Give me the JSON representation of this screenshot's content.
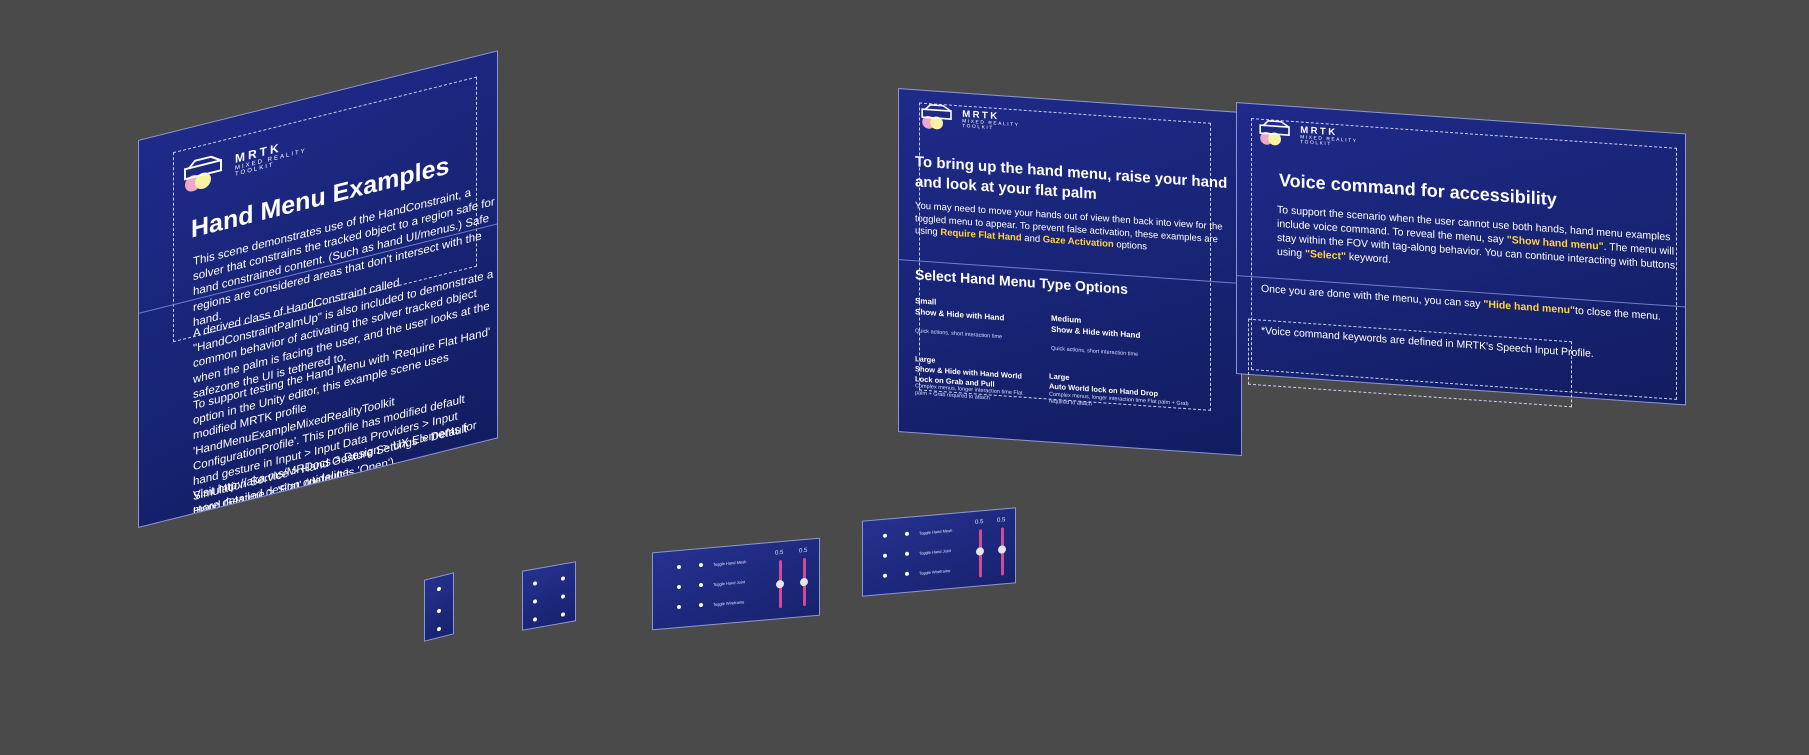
{
  "logo": {
    "title": "MRTK",
    "subtitle_line1": "MIXED REALITY",
    "subtitle_line2": "TOOLKIT"
  },
  "left_panel": {
    "title": "Hand Menu Examples",
    "para1": "This scene demonstrates use of the HandConstraint, a solver that constrains the tracked object to a region safe for hand constrained content. (Such as hand UI/menus.) Safe regions are considered areas that don't intersect with the hand.",
    "para2": "A derived class of HandConstraint called \"HandConstraintPalmUp\" is also included to demonstrate a common behavior of activating the solver tracked object when the palm is facing the user, and the user looks at the safezone the UI is tethered to.",
    "para3": "To support testing the Hand Menu with 'Require Flat Hand' option in the Unity editor, this example scene uses modified MRTK profile 'HandMenuExampleMixedRealityToolkit ConfigurationProfile'. This profile has modified default hand gesture in Input > Input Data Providers > Input Simulation Service > Hand Gesture Settings > Default Hand Gesture > 'Flat' (default is 'Open')",
    "para4": "Visit http://aka.ms/MRDocs > Design > UX Elements for more detailed design guideline."
  },
  "mid_panel": {
    "title": "To bring up the hand menu, raise your hand and look at your flat palm",
    "para_pre": "You may need to move your hands out of view then back into view for the toggled menu to appear. To prevent false activation, these examples are using ",
    "hl1": "Require Flat Hand",
    "para_mid": " and ",
    "hl2": "Gaze Activation",
    "para_post": " options",
    "section_title": "Select Hand Menu Type Options",
    "options": [
      {
        "size": "Small",
        "name": "Show & Hide with Hand",
        "desc": "Quick actions, short interaction time"
      },
      {
        "size": "Medium",
        "name": "Show & Hide with Hand",
        "desc": "Quick actions, short interaction time"
      },
      {
        "size": "Large",
        "name": "Show & Hide with Hand World Lock on Grab and Pull",
        "desc": "Complex menus, longer interaction time Flat palm + Grab required to attach"
      },
      {
        "size": "Large",
        "name": "Auto World lock on Hand Drop",
        "desc": "Complex menus, longer interaction time Flat palm + Grab required to attach"
      }
    ]
  },
  "right_panel": {
    "title": "Voice command for accessibility",
    "p1_pre": "To support the scenario when the user cannot use both hands, hand menu examples include voice command. To reveal the menu, say ",
    "p1_hl": "\"Show hand menu\"",
    "p1_mid": ". The menu will stay within the FOV with tag-along behavior. You can continue interacting with buttons using ",
    "p1_hl2": "\"Select\"",
    "p1_post": " keyword.",
    "p2_pre": "Once you are done with the menu, you can say ",
    "p2_hl": "\"Hide hand menu\"",
    "p2_post": "to close the menu.",
    "p3": "*Voice command keywords are defined in MRTK's Speech Input Profile."
  },
  "mini_menus": {
    "menu3_rows": [
      "Toggle Hand Mesh",
      "Toggle Hand Joint",
      "Toggle Wireframe"
    ],
    "menu3_values": [
      "0.5",
      "0.5"
    ],
    "menu4_rows": [
      "Toggle Hand Mesh",
      "Toggle Hand Joint",
      "Toggle Wireframe"
    ],
    "menu4_values": [
      "0.5",
      "0.5"
    ]
  }
}
